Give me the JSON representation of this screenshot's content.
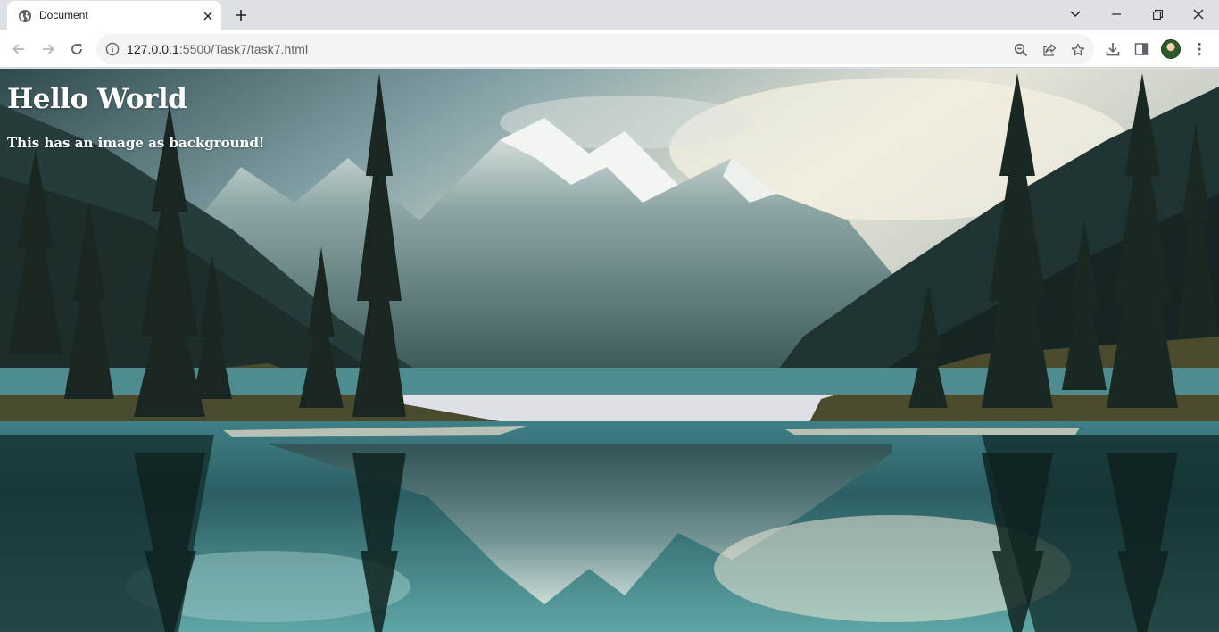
{
  "browser": {
    "tab": {
      "title": "Document",
      "favicon": "globe-icon"
    },
    "url": {
      "host": "127.0.0.1",
      "rest": ":5500/Task7/task7.html"
    },
    "icons": {
      "back": "arrow-left-icon",
      "forward": "arrow-right-icon",
      "reload": "reload-icon",
      "site_info": "info-icon",
      "zoom": "zoom-out-icon",
      "share": "share-icon",
      "bookmark": "star-icon",
      "downloads": "download-icon",
      "side_panel": "side-panel-icon",
      "menu": "kebab-menu-icon"
    }
  },
  "page": {
    "heading": "Hello World",
    "paragraph": "This has an image as background!",
    "background": "mountain-lake-landscape"
  },
  "colors": {
    "chrome_frame": "#dee1e6",
    "toolbar": "#ffffff",
    "omnibox": "#f1f3f4",
    "page_text": "#ffffff"
  }
}
